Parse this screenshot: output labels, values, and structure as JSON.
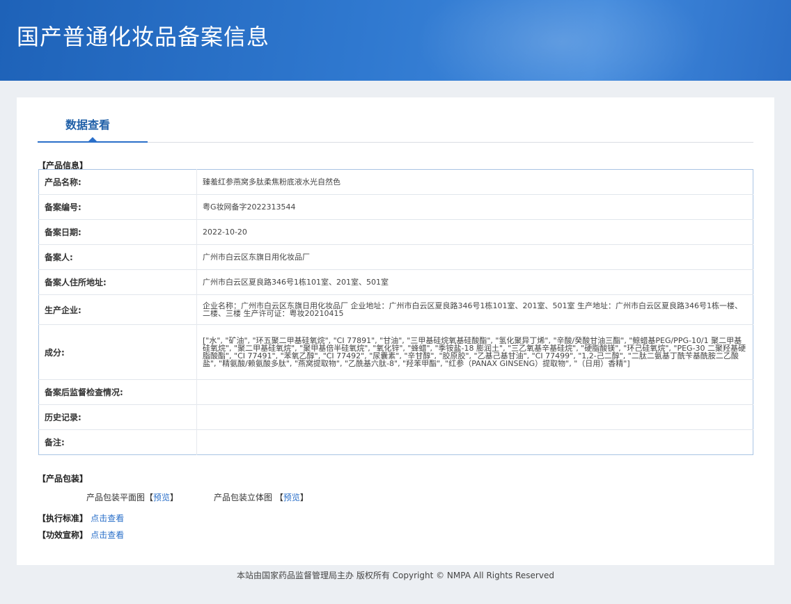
{
  "header": {
    "title": "国产普通化妆品备案信息"
  },
  "tabs": {
    "active_label": "数据查看"
  },
  "product_info": {
    "section_label": "【产品信息】",
    "rows": [
      {
        "label": "产品名称:",
        "value": "臻羞红参燕窝多肽柔焦粉底液水光自然色"
      },
      {
        "label": "备案编号:",
        "value": "粤G妆网备字2022313544"
      },
      {
        "label": "备案日期:",
        "value": "2022-10-20"
      },
      {
        "label": "备案人:",
        "value": "广州市白云区东旗日用化妆品厂"
      },
      {
        "label": "备案人住所地址:",
        "value": "广州市白云区夏良路346号1栋101室、201室、501室"
      },
      {
        "label": "生产企业:",
        "value": "企业名称：广州市白云区东旗日用化妆品厂 企业地址：广州市白云区夏良路346号1栋101室、201室、501室 生产地址：广州市白云区夏良路346号1栋一楼、二楼、三楼 生产许可证：粤妆20210415"
      },
      {
        "label": "成分:",
        "value": "[\"水\", \"矿油\", \"环五聚二甲基硅氧烷\", \"CI 77891\", \"甘油\", \"三甲基硅烷氧基硅酸酯\", \"氢化聚异丁烯\", \"辛酸/癸酸甘油三酯\", \"鲸蜡基PEG/PPG-10/1 聚二甲基硅氧烷\", \"聚二甲基硅氧烷\", \"聚甲基倍半硅氧烷\", \"氧化锌\", \"蜂蜡\", \"季铵盐-18 膨润土\", \"三乙氧基辛基硅烷\", \"硬脂酸镁\", \"环己硅氧烷\", \"PEG-30 二聚羟基硬脂酸酯\", \"CI 77491\", \"苯氧乙醇\", \"CI 77492\", \"尿囊素\", \"辛甘醇\", \"胶原胶\", \"乙基己基甘油\", \"CI 77499\", \"1,2-己二醇\", \"二肽二氨基丁酰苄基酰胺二乙酸盐\", \"精氨酸/赖氨酸多肽\", \"燕窝提取物\", \"乙酰基六肽-8\", \"羟苯甲酯\", \"红参（PANAX GINSENG）提取物\", \"（日用）香精\"]"
      },
      {
        "label": "备案后监督检查情况:",
        "value": ""
      },
      {
        "label": "历史记录:",
        "value": ""
      },
      {
        "label": "备注:",
        "value": ""
      }
    ]
  },
  "packaging": {
    "section_label": "【产品包装】",
    "flat_label": "产品包装平面图",
    "solid_label": "产品包装立体图",
    "bracket_open": "【",
    "bracket_close": "】",
    "preview_label": "预览"
  },
  "standard": {
    "label": "【执行标准】",
    "link": "点击查看"
  },
  "efficacy": {
    "label": "【功效宣称】",
    "link": "点击查看"
  },
  "footer": {
    "text": "本站由国家药品监督管理局主办 版权所有 Copyright © NMPA All Rights Reserved"
  }
}
